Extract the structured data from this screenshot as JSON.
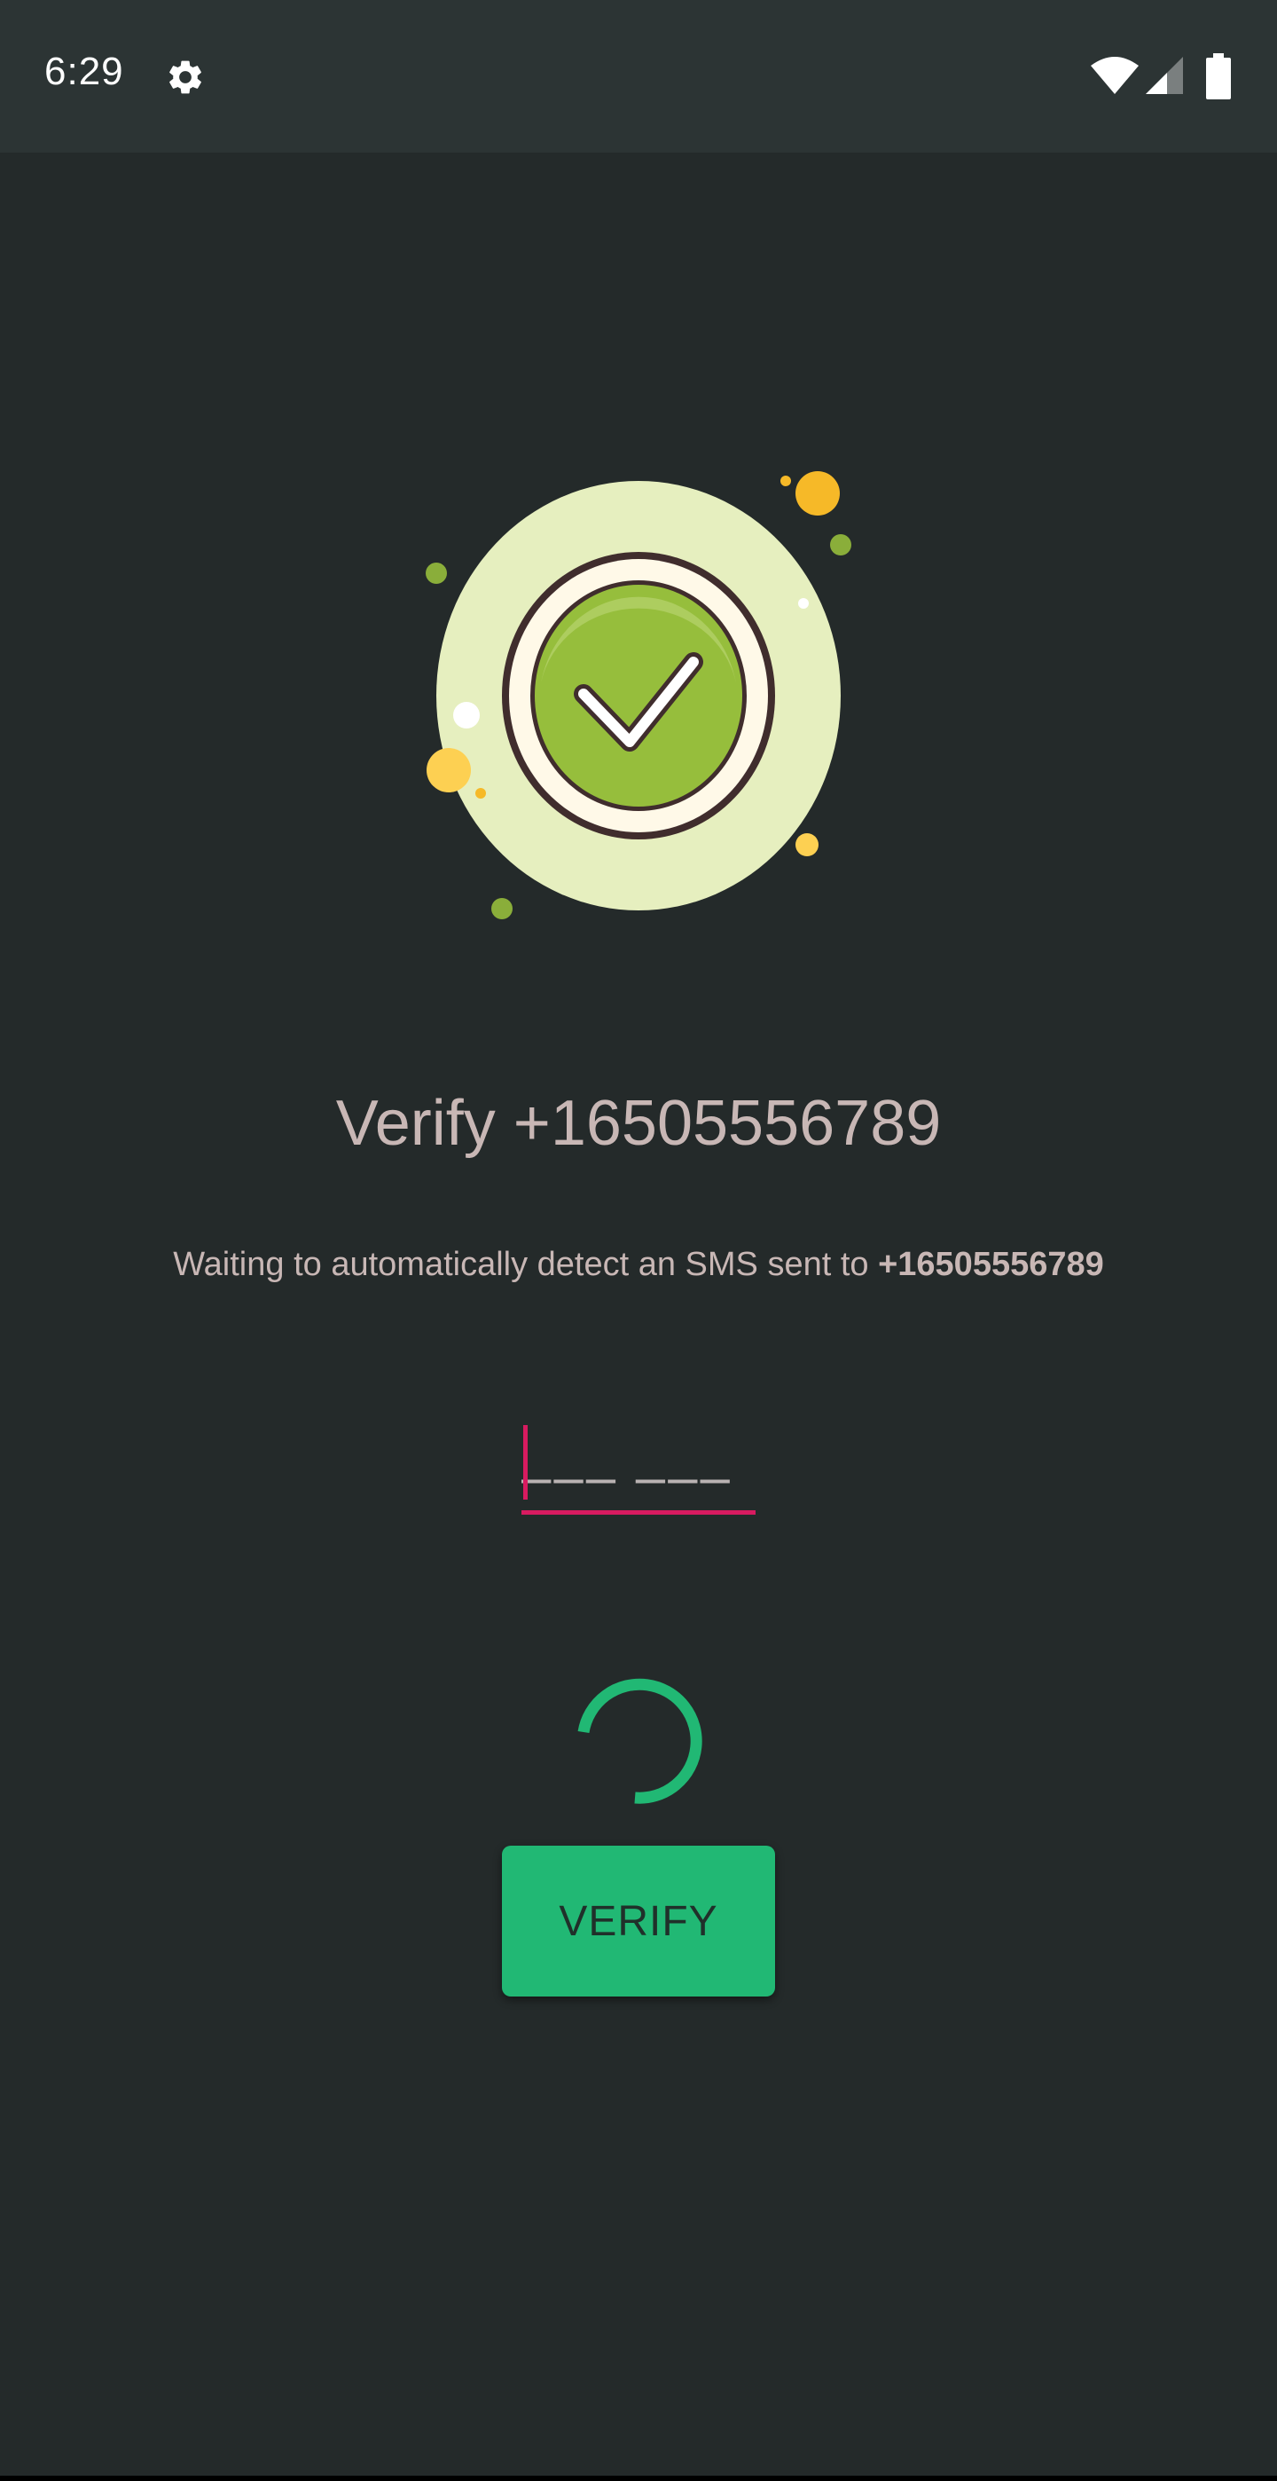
{
  "status_bar": {
    "time": "6:29",
    "icons": [
      "gear-icon",
      "wifi-icon",
      "cell-signal-icon",
      "battery-icon"
    ]
  },
  "illustration": {
    "name": "verified-check-illustration",
    "colors": {
      "outer": "#e6efbf",
      "ring_dark": "#402d2d",
      "ring_light": "#fff9e8",
      "inner": "#96be3c",
      "dot_yellow": "#f6b928",
      "dot_green": "#8aae3a"
    }
  },
  "title": "Verify +16505556789",
  "subtitle": {
    "prefix": "Waiting to automatically detect an SMS sent to ",
    "phone": "+16505556789"
  },
  "code_input": {
    "placeholder": "––– –––",
    "value": ""
  },
  "verify_button": {
    "label": "VERIFY"
  },
  "colors": {
    "background": "#242a2a",
    "status_bar": "#2c3434",
    "accent": "#21b874",
    "cursor": "#d81b60",
    "text": "#c8b7b5"
  }
}
